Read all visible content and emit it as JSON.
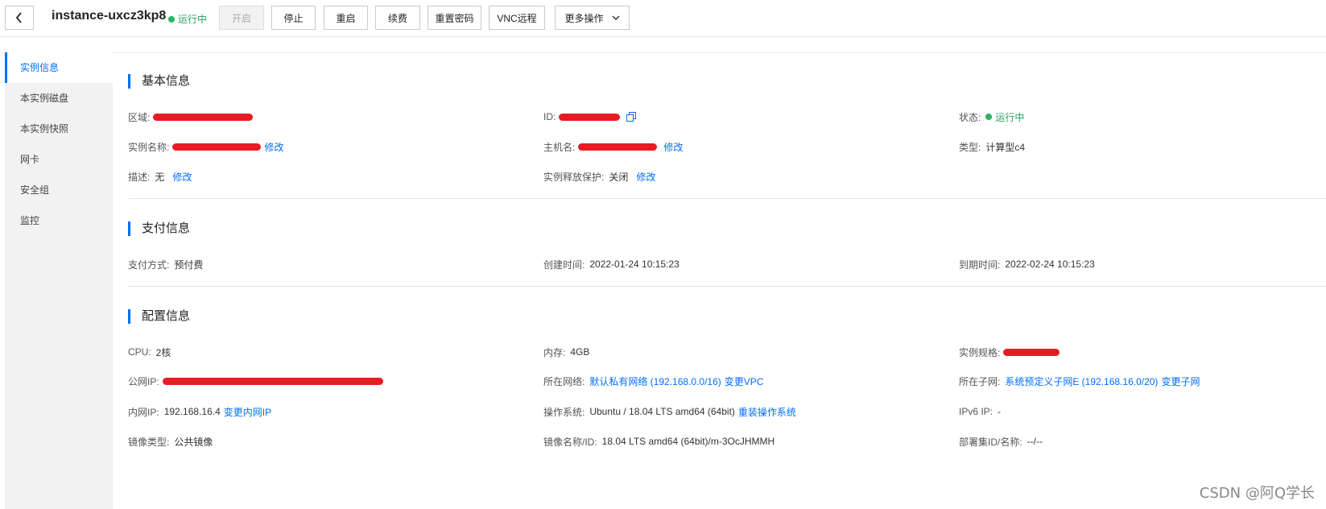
{
  "header": {
    "instance_name": "instance-uxcz3kp8",
    "status": "运行中",
    "buttons": {
      "start": "开启",
      "stop": "停止",
      "restart": "重启",
      "renew": "续费",
      "reset_password": "重置密码",
      "vnc": "VNC远程",
      "more": "更多操作"
    }
  },
  "sidebar": {
    "items": [
      {
        "label": "实例信息"
      },
      {
        "label": "本实例磁盘"
      },
      {
        "label": "本实例快照"
      },
      {
        "label": "网卡"
      },
      {
        "label": "安全组"
      },
      {
        "label": "监控"
      }
    ]
  },
  "basic": {
    "title": "基本信息",
    "region_label": "区域:",
    "id_label": "ID:",
    "state_label": "状态:",
    "state_value": "运行中",
    "name_label": "实例名称:",
    "name_edit": "修改",
    "hostname_label": "主机名:",
    "hostname_edit": "修改",
    "type_label": "类型:",
    "type_value": "计算型c4",
    "desc_label": "描述:",
    "desc_value": "无",
    "desc_edit": "修改",
    "release_label": "实例释放保护:",
    "release_value": "关闭",
    "release_edit": "修改"
  },
  "payment": {
    "title": "支付信息",
    "method_label": "支付方式:",
    "method_value": "预付费",
    "created_label": "创建时间:",
    "created_value": "2022-01-24 10:15:23",
    "expire_label": "到期时间:",
    "expire_value": "2022-02-24 10:15:23"
  },
  "config": {
    "title": "配置信息",
    "cpu_label": "CPU:",
    "cpu_value": "2核",
    "mem_label": "内存:",
    "mem_value": "4GB",
    "spec_label": "实例规格:",
    "public_ip_label": "公网IP:",
    "network_label": "所在网络:",
    "network_value": "默认私有网络 (192.168.0.0/16)",
    "network_action": "变更VPC",
    "subnet_label": "所在子网:",
    "subnet_value": "系统预定义子网E (192.168.16.0/20)",
    "subnet_action": "变更子网",
    "private_ip_label": "内网IP:",
    "private_ip_value": "192.168.16.4",
    "private_ip_action": "变更内网IP",
    "os_label": "操作系统:",
    "os_value": "Ubuntu / 18.04 LTS amd64 (64bit)",
    "os_action": "重装操作系统",
    "ipv6_label": "IPv6 IP:",
    "ipv6_value": "-",
    "image_type_label": "镜像类型:",
    "image_type_value": "公共镜像",
    "image_name_label": "镜像名称/ID:",
    "image_name_value": "18.04 LTS amd64 (64bit)/m-3OcJHMMH",
    "deploy_label": "部署集ID/名称:",
    "deploy_value": "--/--"
  },
  "watermark": "CSDN @阿Q学长",
  "colors": {
    "accent": "#006eff",
    "running": "#29a55a",
    "redaction": "#e81b24"
  }
}
